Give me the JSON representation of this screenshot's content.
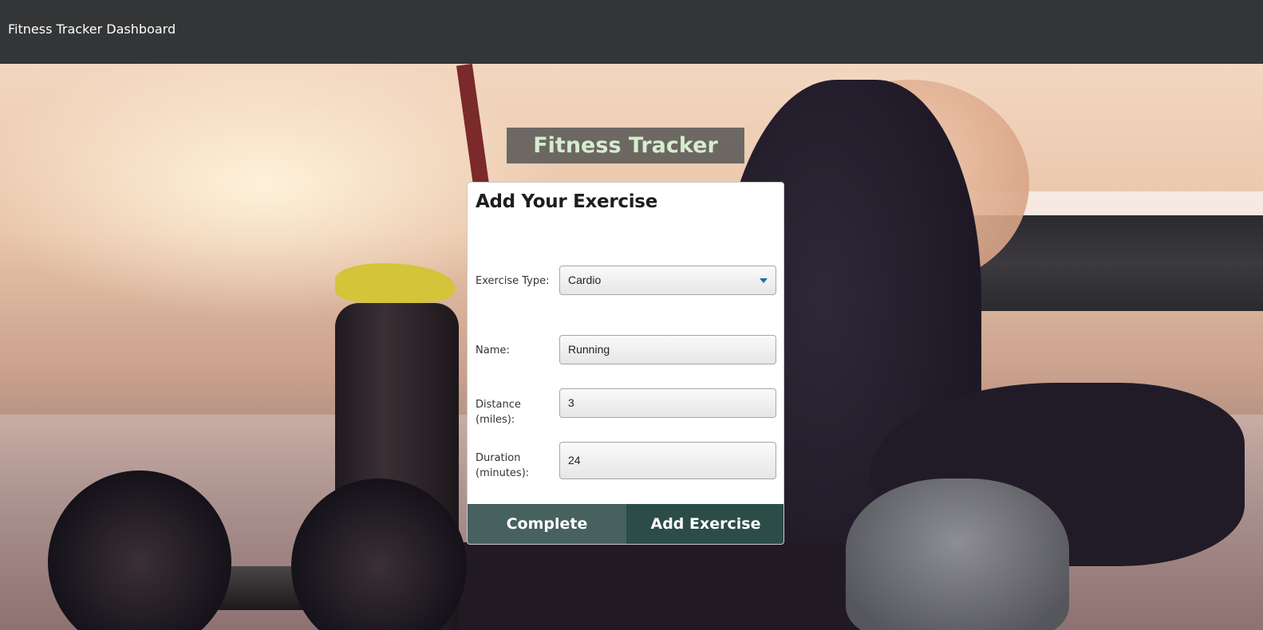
{
  "navbar": {
    "brand": "Fitness Tracker Dashboard"
  },
  "app_title": "Fitness Tracker",
  "form": {
    "heading": "Add Your Exercise",
    "exercise_type": {
      "label": "Exercise Type:",
      "value": "Cardio"
    },
    "name": {
      "label": "Name:",
      "value": "Running"
    },
    "distance": {
      "label": "Distance (miles):",
      "value": "3"
    },
    "duration": {
      "label": "Duration (minutes):",
      "value": "24"
    }
  },
  "buttons": {
    "complete": "Complete",
    "add": "Add Exercise"
  },
  "colors": {
    "navbar_bg": "#343536",
    "title_text": "#d6ecce",
    "complete_button": "#47615e",
    "add_button": "#2c4d47",
    "select_arrow": "#1b6f9e"
  },
  "icons": {
    "select_arrow": "caret-down-icon"
  }
}
